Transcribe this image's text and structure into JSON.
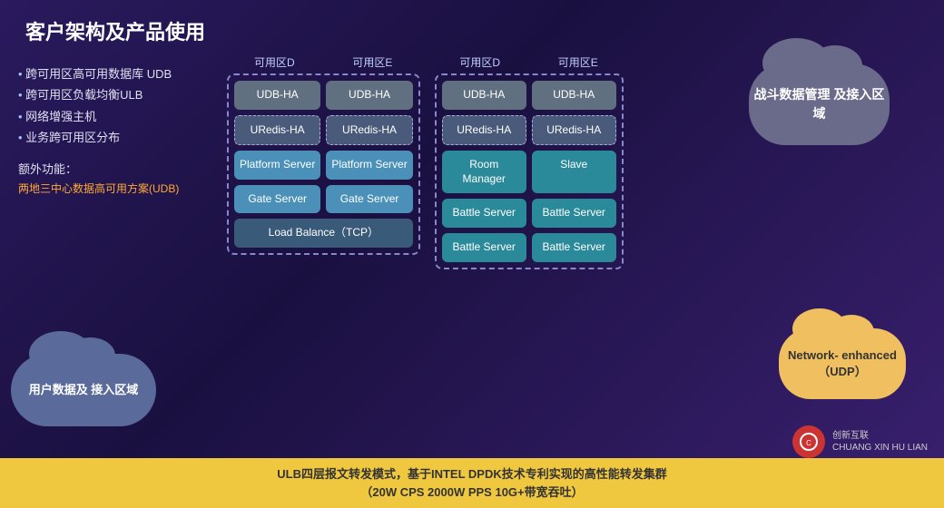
{
  "title": "客户架构及产品使用",
  "left_panel": {
    "items": [
      "跨可用区高可用数据库 UDB",
      "跨可用区负载均衡ULB",
      "网络增强主机",
      "业务跨可用区分布"
    ],
    "extra_title": "额外功能：",
    "extra_link": "两地三中心数据高可用方案(UDB)"
  },
  "cloud_left": {
    "text": "用户数据及\n接入区域"
  },
  "cloud_right": {
    "text": "战斗数据管理\n及接入区域"
  },
  "cloud_network": {
    "text": "Network-\nenhanced\n（UDP）"
  },
  "left_cluster": {
    "zone_d": "可用区D",
    "zone_e": "可用区E",
    "row1": {
      "d": "UDB-HA",
      "e": "UDB-HA"
    },
    "row2": {
      "d": "URedis-HA",
      "e": "URedis-HA"
    },
    "row3": {
      "d": "Platform\nServer",
      "e": "Platform\nServer"
    },
    "row4": {
      "d": "Gate\nServer",
      "e": "Gate\nServer"
    },
    "row5": {
      "span": "Load Balance（TCP）"
    }
  },
  "right_cluster": {
    "zone_d": "可用区D",
    "zone_e": "可用区E",
    "row1": {
      "d": "UDB-HA",
      "e": "UDB-HA"
    },
    "row2": {
      "d": "URedis-HA",
      "e": "URedis-HA"
    },
    "row3": {
      "d": "Room\nManager",
      "e": "Slave"
    },
    "row4a": {
      "d": "Battle\nServer",
      "e": "Battle\nServer"
    },
    "row4b": {
      "d": "Battle\nServer",
      "e": "Battle\nServer"
    }
  },
  "bottom_banner": {
    "line1": "ULB四层报文转发模式，基于INTEL DPDK技术专利实现的高性能转发集群",
    "line2": "（20W CPS  2000W PPS 10G+带宽吞吐）"
  },
  "logo": {
    "company": "创新互联",
    "tagline": "CHUANG XIN HU LIAN"
  }
}
